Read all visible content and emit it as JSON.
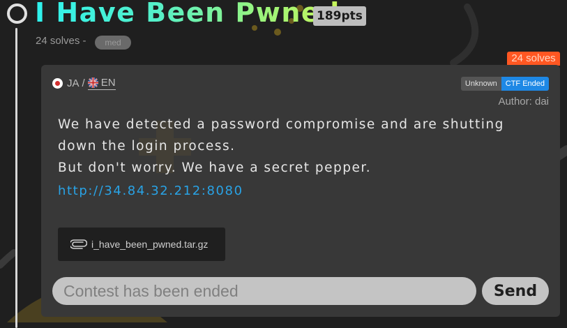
{
  "challenge": {
    "title": "I Have Been Pwned",
    "points": "189pts",
    "solves_text": "24 solves -",
    "difficulty": "med",
    "solves_badge": "24 solves"
  },
  "language": {
    "ja": "JA",
    "separator": "/",
    "en": "EN"
  },
  "status": {
    "unknown": "Unknown",
    "ctf_ended": "CTF Ended"
  },
  "author": "Author: dai",
  "description": {
    "line1": "We have detected a password compromise and are shutting down the login process.",
    "line2": "But don't worry. We have a secret pepper."
  },
  "url": "http://34.84.32.212:8080",
  "attachment": {
    "filename": "i_have_been_pwned.tar.gz",
    "icon": "paperclip-icon"
  },
  "submit": {
    "placeholder": "Contest has been ended",
    "button_label": "Send"
  },
  "colors": {
    "accent_title_start": "#2ef2ee",
    "accent_title_end": "#c8f55a",
    "solves_badge": "#ff5722",
    "ctf_ended": "#1e88e5",
    "link": "#29a3e6",
    "card_bg": "#383838",
    "page_bg": "#1f1f1f"
  }
}
